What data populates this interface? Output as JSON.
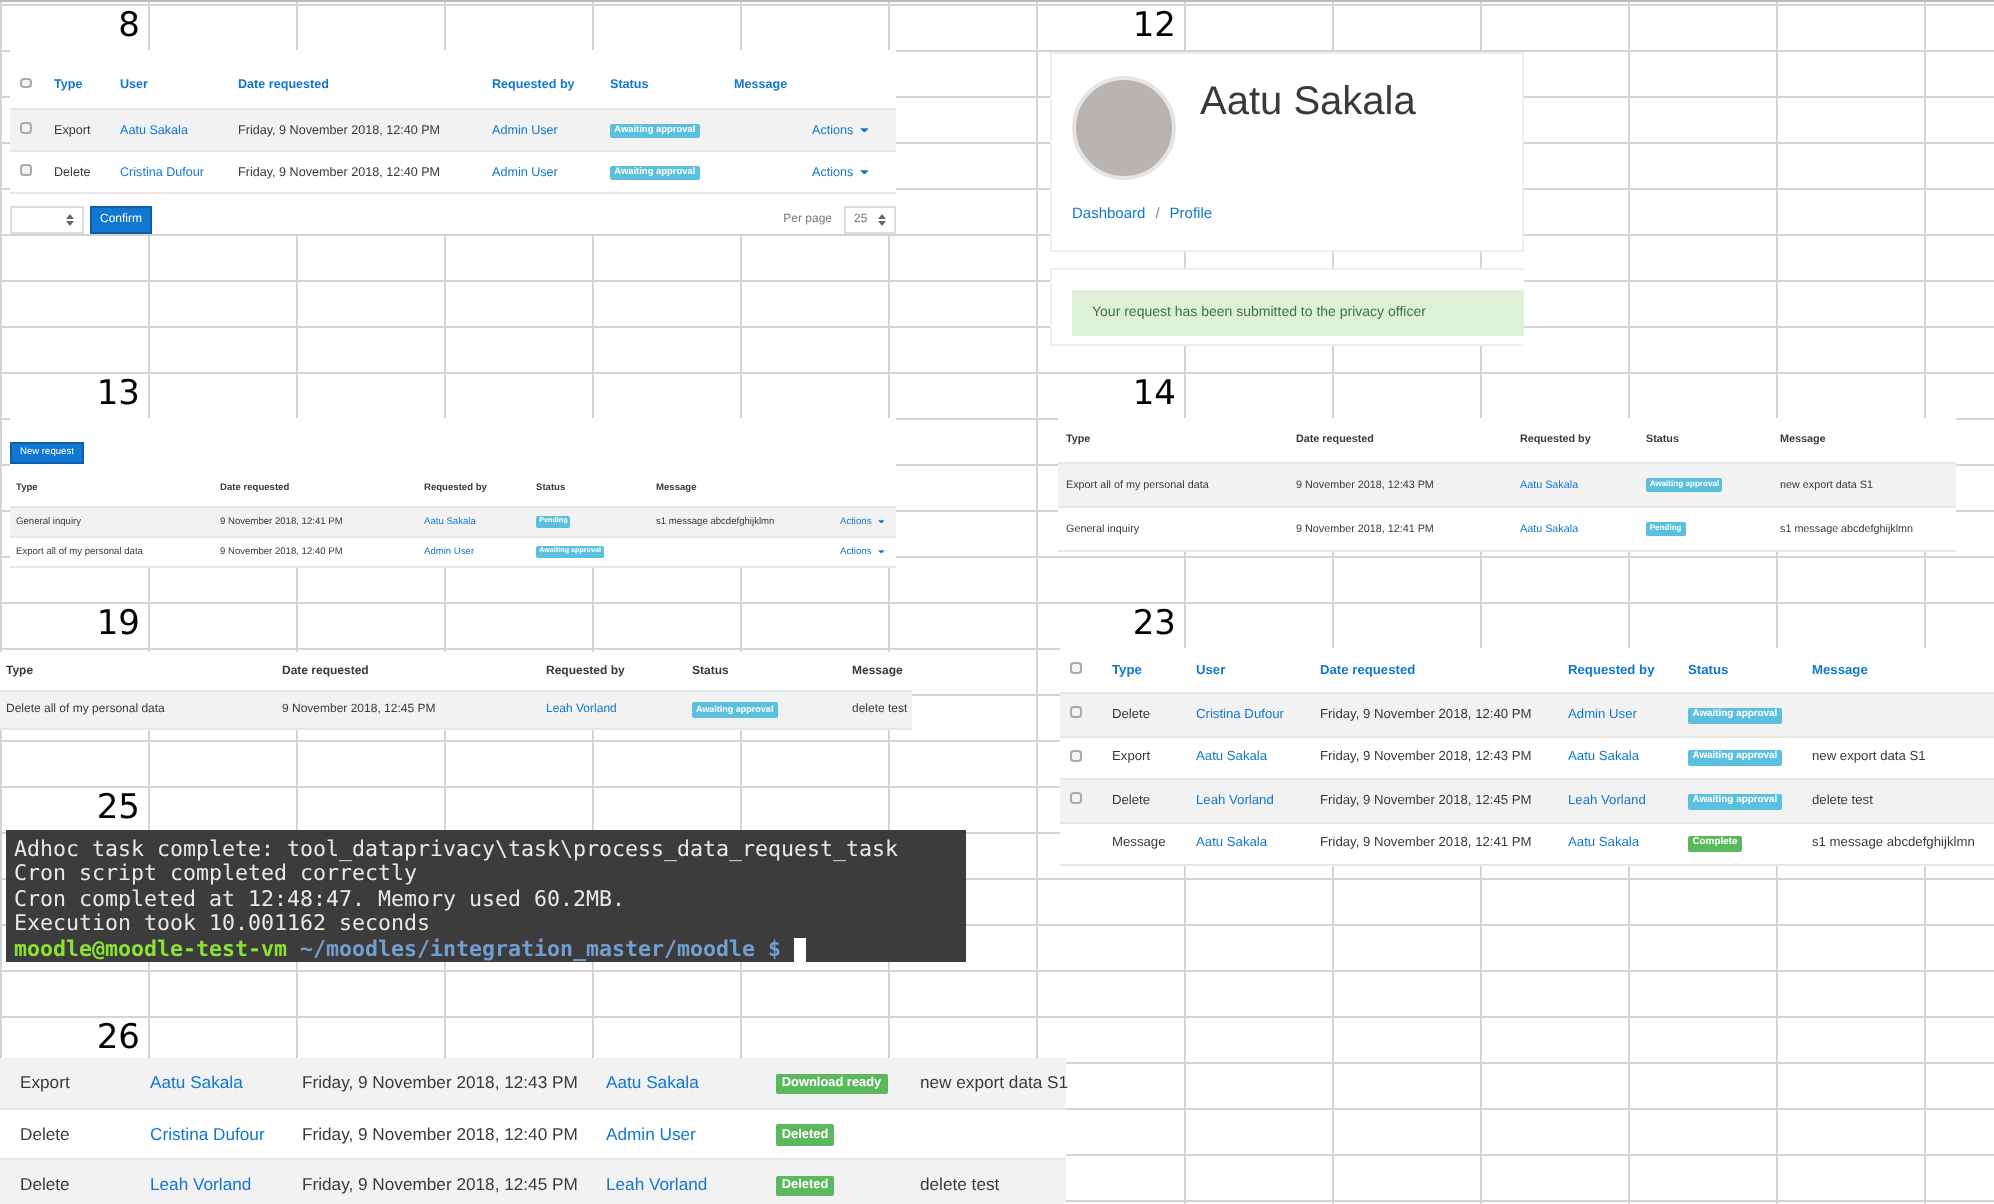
{
  "panels": [
    {
      "kind": "table",
      "label": "8",
      "columns": [
        {
          "kind": "checkbox",
          "checked": false
        },
        {
          "kind": "sort",
          "text": "Type"
        },
        {
          "kind": "sort",
          "text": "User"
        },
        {
          "kind": "sort",
          "text": "Date requested"
        },
        {
          "kind": "sort",
          "text": "Requested by"
        },
        {
          "kind": "sort",
          "text": "Status"
        },
        {
          "kind": "sort",
          "text": "Message"
        },
        {
          "kind": "blank"
        }
      ],
      "rows": [
        [
          {
            "kind": "checkbox",
            "checked": false
          },
          {
            "kind": "text",
            "text": "Export"
          },
          {
            "kind": "link",
            "text": "Aatu Sakala"
          },
          {
            "kind": "text",
            "text": "Friday, 9 November 2018, 12:40 PM"
          },
          {
            "kind": "link",
            "text": "Admin User"
          },
          {
            "kind": "badge",
            "text": "Awaiting approval",
            "color": "#5bc0de"
          },
          {
            "kind": "blank"
          },
          {
            "kind": "actions",
            "text": "Actions"
          }
        ],
        [
          {
            "kind": "checkbox",
            "checked": false
          },
          {
            "kind": "text",
            "text": "Delete"
          },
          {
            "kind": "link",
            "text": "Cristina Dufour"
          },
          {
            "kind": "text",
            "text": "Friday, 9 November 2018, 12:40 PM"
          },
          {
            "kind": "link",
            "text": "Admin User"
          },
          {
            "kind": "badge",
            "text": "Awaiting approval",
            "color": "#5bc0de"
          },
          {
            "kind": "blank"
          },
          {
            "kind": "actions",
            "text": "Actions"
          }
        ]
      ],
      "footer": {
        "confirm_button": "Confirm",
        "per_page_label": "Per page",
        "per_page_value": "25"
      }
    },
    {
      "kind": "profile",
      "label": "12",
      "name": "Aatu Sakala",
      "breadcrumb": [
        "Dashboard",
        "Profile"
      ],
      "separator": "/",
      "alert": "Your request has been submitted to the privacy officer"
    },
    {
      "kind": "table",
      "label": "13",
      "top_button": "New request",
      "columns": [
        {
          "kind": "plain",
          "text": "Type"
        },
        {
          "kind": "plain",
          "text": "Date requested"
        },
        {
          "kind": "plain",
          "text": "Requested by"
        },
        {
          "kind": "plain",
          "text": "Status"
        },
        {
          "kind": "plain",
          "text": "Message"
        },
        {
          "kind": "blank"
        }
      ],
      "rows": [
        [
          {
            "kind": "text",
            "text": "General inquiry"
          },
          {
            "kind": "text",
            "text": "9 November 2018, 12:41 PM"
          },
          {
            "kind": "link",
            "text": "Aatu Sakala"
          },
          {
            "kind": "badge",
            "text": "Pending",
            "color": "#5bc0de"
          },
          {
            "kind": "text",
            "text": "s1 message abcdefghijklmn"
          },
          {
            "kind": "actions",
            "text": "Actions"
          }
        ],
        [
          {
            "kind": "text",
            "text": "Export all of my personal data"
          },
          {
            "kind": "text",
            "text": "9 November 2018, 12:40 PM"
          },
          {
            "kind": "link",
            "text": "Admin User"
          },
          {
            "kind": "badge",
            "text": "Awaiting approval",
            "color": "#5bc0de"
          },
          {
            "kind": "blank"
          },
          {
            "kind": "actions",
            "text": "Actions"
          }
        ]
      ]
    },
    {
      "kind": "table",
      "label": "14",
      "columns": [
        {
          "kind": "plain",
          "text": "Type"
        },
        {
          "kind": "plain",
          "text": "Date requested"
        },
        {
          "kind": "plain",
          "text": "Requested by"
        },
        {
          "kind": "plain",
          "text": "Status"
        },
        {
          "kind": "plain",
          "text": "Message"
        }
      ],
      "rows": [
        [
          {
            "kind": "text",
            "text": "Export all of my personal data"
          },
          {
            "kind": "text",
            "text": "9 November 2018, 12:43 PM"
          },
          {
            "kind": "link",
            "text": "Aatu Sakala"
          },
          {
            "kind": "badge",
            "text": "Awaiting approval",
            "color": "#5bc0de"
          },
          {
            "kind": "text",
            "text": "new export data S1"
          }
        ],
        [
          {
            "kind": "text",
            "text": "General inquiry"
          },
          {
            "kind": "text",
            "text": "9 November 2018, 12:41 PM"
          },
          {
            "kind": "link",
            "text": "Aatu Sakala"
          },
          {
            "kind": "badge",
            "text": "Pending",
            "color": "#5bc0de"
          },
          {
            "kind": "text",
            "text": "s1 message abcdefghijklmn"
          }
        ]
      ]
    },
    {
      "kind": "table",
      "label": "19",
      "columns": [
        {
          "kind": "plain",
          "text": "Type"
        },
        {
          "kind": "plain",
          "text": "Date requested"
        },
        {
          "kind": "plain",
          "text": "Requested by"
        },
        {
          "kind": "plain",
          "text": "Status"
        },
        {
          "kind": "plain",
          "text": "Message"
        }
      ],
      "rows": [
        [
          {
            "kind": "text",
            "text": "Delete all of my personal data"
          },
          {
            "kind": "text",
            "text": "9 November 2018, 12:45 PM"
          },
          {
            "kind": "link",
            "text": "Leah Vorland"
          },
          {
            "kind": "badge",
            "text": "Awaiting approval",
            "color": "#5bc0de"
          },
          {
            "kind": "text",
            "text": "delete test"
          }
        ]
      ]
    },
    {
      "kind": "table",
      "label": "23",
      "columns": [
        {
          "kind": "checkbox",
          "checked": false
        },
        {
          "kind": "sort",
          "text": "Type"
        },
        {
          "kind": "sort",
          "text": "User"
        },
        {
          "kind": "sort",
          "text": "Date requested"
        },
        {
          "kind": "sort",
          "text": "Requested by"
        },
        {
          "kind": "sort",
          "text": "Status"
        },
        {
          "kind": "sort",
          "text": "Message"
        }
      ],
      "rows": [
        [
          {
            "kind": "checkbox",
            "checked": false
          },
          {
            "kind": "text",
            "text": "Delete"
          },
          {
            "kind": "link",
            "text": "Cristina Dufour"
          },
          {
            "kind": "text",
            "text": "Friday, 9 November 2018, 12:40 PM"
          },
          {
            "kind": "link",
            "text": "Admin User"
          },
          {
            "kind": "badge",
            "text": "Awaiting approval",
            "color": "#5bc0de"
          },
          {
            "kind": "blank"
          }
        ],
        [
          {
            "kind": "checkbox",
            "checked": false
          },
          {
            "kind": "text",
            "text": "Export"
          },
          {
            "kind": "link",
            "text": "Aatu Sakala"
          },
          {
            "kind": "text",
            "text": "Friday, 9 November 2018, 12:43 PM"
          },
          {
            "kind": "link",
            "text": "Aatu Sakala"
          },
          {
            "kind": "badge",
            "text": "Awaiting approval",
            "color": "#5bc0de"
          },
          {
            "kind": "text",
            "text": "new export data S1"
          }
        ],
        [
          {
            "kind": "checkbox",
            "checked": false
          },
          {
            "kind": "text",
            "text": "Delete"
          },
          {
            "kind": "link",
            "text": "Leah Vorland"
          },
          {
            "kind": "text",
            "text": "Friday, 9 November 2018, 12:45 PM"
          },
          {
            "kind": "link",
            "text": "Leah Vorland"
          },
          {
            "kind": "badge",
            "text": "Awaiting approval",
            "color": "#5bc0de"
          },
          {
            "kind": "text",
            "text": "delete test"
          }
        ],
        [
          {
            "kind": "blank"
          },
          {
            "kind": "text",
            "text": "Message"
          },
          {
            "kind": "link",
            "text": "Aatu Sakala"
          },
          {
            "kind": "text",
            "text": "Friday, 9 November 2018, 12:41 PM"
          },
          {
            "kind": "link",
            "text": "Aatu Sakala"
          },
          {
            "kind": "badge",
            "text": "Complete",
            "color": "#5cb85c"
          },
          {
            "kind": "text",
            "text": "s1 message abcdefghijklmn"
          }
        ]
      ]
    },
    {
      "kind": "terminal",
      "label": "25",
      "lines": [
        {
          "kind": "output",
          "text": "Adhoc task complete: tool_dataprivacy\\task\\process_data_request_task"
        },
        {
          "kind": "output",
          "text": "Cron script completed correctly"
        },
        {
          "kind": "output",
          "text": "Cron completed at 12:48:47. Memory used 60.2MB."
        },
        {
          "kind": "output",
          "text": "Execution took 10.001162 seconds"
        },
        {
          "kind": "prompt",
          "user_host": "moodle@moodle-test-vm",
          "path": "~/moodles/integration_master/moodle $"
        }
      ]
    },
    {
      "kind": "table",
      "label": "26",
      "rows": [
        [
          {
            "kind": "text",
            "text": "Export"
          },
          {
            "kind": "link",
            "text": "Aatu Sakala"
          },
          {
            "kind": "text",
            "text": "Friday, 9 November 2018, 12:43 PM"
          },
          {
            "kind": "link",
            "text": "Aatu Sakala"
          },
          {
            "kind": "badge",
            "text": "Download ready",
            "color": "#5cb85c"
          },
          {
            "kind": "text",
            "text": "new export data S1"
          }
        ],
        [
          {
            "kind": "text",
            "text": "Delete"
          },
          {
            "kind": "link",
            "text": "Cristina Dufour"
          },
          {
            "kind": "text",
            "text": "Friday, 9 November 2018, 12:40 PM"
          },
          {
            "kind": "link",
            "text": "Admin User"
          },
          {
            "kind": "badge",
            "text": "Deleted",
            "color": "#5cb85c"
          },
          {
            "kind": "blank"
          }
        ],
        [
          {
            "kind": "text",
            "text": "Delete"
          },
          {
            "kind": "link",
            "text": "Leah Vorland"
          },
          {
            "kind": "text",
            "text": "Friday, 9 November 2018, 12:45 PM"
          },
          {
            "kind": "link",
            "text": "Leah Vorland"
          },
          {
            "kind": "badge",
            "text": "Deleted",
            "color": "#5cb85c"
          },
          {
            "kind": "text",
            "text": "delete test"
          }
        ]
      ]
    }
  ]
}
